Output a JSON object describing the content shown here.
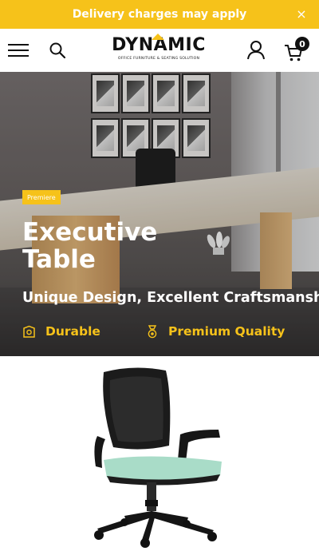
{
  "announcement": {
    "text": "Delivery charges may apply",
    "close_glyph": "×"
  },
  "header": {
    "menu_icon": "hamburger-menu-icon",
    "search_icon": "search-icon",
    "logo": {
      "wordmark": "DYNAMIC",
      "tagline": "OFFICE FURNITURE & SEATING SOLUTION"
    },
    "account_icon": "user-icon",
    "cart_icon": "cart-icon",
    "cart_count": "0"
  },
  "hero": {
    "badge": "Premiere",
    "title": "Executive Table",
    "subtitle": "Unique Design, Excellent Craftsmanship!",
    "features": [
      {
        "icon": "shield-badge-icon",
        "label": "Durable"
      },
      {
        "icon": "medal-icon",
        "label": "Premium Quality"
      }
    ]
  },
  "product": {
    "image": "office-chair-image"
  },
  "colors": {
    "accent": "#f6c21a",
    "text_dark": "#111111",
    "chair_seat": "#a9dcc8"
  }
}
